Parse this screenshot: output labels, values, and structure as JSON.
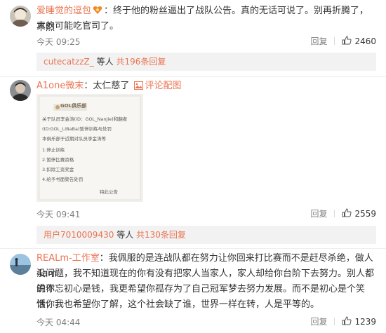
{
  "comments": [
    {
      "username": "爱睡觉的逗包",
      "text_line1": "：终于他的粉丝逼出了战队公告。真的无话可说了。别再折腾了，不然",
      "text_line2": "真的可能吃官司了。",
      "time": "今天 09:25",
      "reply_label": "回复",
      "likes": "2460",
      "subreply": {
        "user": "cutecatzzZ_",
        "mid": "等人",
        "count": "共196条回复"
      }
    },
    {
      "username": "A1one微末",
      "text": "：太仁慈了",
      "pic_label": "评论配图",
      "time": "今天 09:41",
      "reply_label": "回复",
      "likes": "2559",
      "subreply": {
        "user": "用户7010009430",
        "mid": "等人",
        "count": "共130条回复"
      },
      "photo": {
        "title": "GOL俱乐部",
        "lines": [
          "关于队员李金涛(ID：GOL_NanJie)和翻者",
          "(ID:GOL_LiBaBa)暂停训练与处罚",
          "本俱乐部于近期对队员李金涛等",
          "1.停止训练",
          "2.暂停比赛资格",
          "3.扣除工资奖金",
          "4.给予书面警告处罚",
          "特此公告"
        ]
      }
    },
    {
      "username": "REALm-工作室",
      "text_line1": "：我佩服的是连战队都在努力让你回来打比赛而不是赶尽杀绝，做人4am",
      "text_line2": "没问题，我不知道现在的你有没有把家人当家人，家人却给你台阶下去努力。别人都说你",
      "text_line3": "的不忘初心是钱，我更希望你孤存为了自己冠军梦去努力发展。而不是初心是个笑话，我",
      "text_line4": "恨你，也希望你了解，这个社会缺了谁，世界一样在转，人是平等的。",
      "time": "今天 04:44",
      "reply_label": "回复",
      "likes": "1239"
    }
  ],
  "colors": {
    "username": "#eb7350",
    "meta": "#808080",
    "subreply_bg": "#f2f2f2"
  }
}
